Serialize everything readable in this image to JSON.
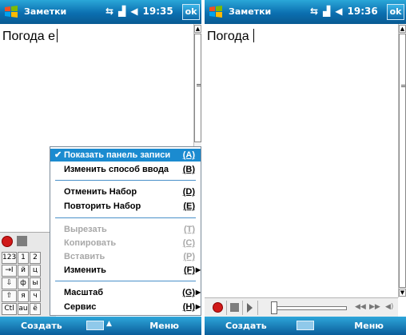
{
  "left": {
    "title": "Заметки",
    "status": {
      "connectivity_icon": "connectivity-icon",
      "signal_icon": "signal-icon",
      "volume_icon": "volume-icon",
      "time": "19:35"
    },
    "ok_label": "ok",
    "note_text": "Погода е",
    "menu": {
      "items": [
        {
          "label": "Показать панель записи",
          "key": "(A)",
          "checked": true,
          "selected": true,
          "disabled": false,
          "submenu": false
        },
        {
          "label": "Изменить способ ввода",
          "key": "(B)",
          "checked": false,
          "selected": false,
          "disabled": false,
          "submenu": false
        },
        {
          "label": "Отменить Набор",
          "key": "(D)",
          "checked": false,
          "selected": false,
          "disabled": false,
          "submenu": false
        },
        {
          "label": "Повторить Набор",
          "key": "(E)",
          "checked": false,
          "selected": false,
          "disabled": false,
          "submenu": false
        },
        {
          "label": "Вырезать",
          "key": "(T)",
          "checked": false,
          "selected": false,
          "disabled": true,
          "submenu": false
        },
        {
          "label": "Копировать",
          "key": "(C)",
          "checked": false,
          "selected": false,
          "disabled": true,
          "submenu": false
        },
        {
          "label": "Вставить",
          "key": "(P)",
          "checked": false,
          "selected": false,
          "disabled": true,
          "submenu": false
        },
        {
          "label": "Изменить",
          "key": "(F)",
          "checked": false,
          "selected": false,
          "disabled": false,
          "submenu": true
        },
        {
          "label": "Масштаб",
          "key": "(G)",
          "checked": false,
          "selected": false,
          "disabled": false,
          "submenu": true
        },
        {
          "label": "Сервис",
          "key": "(H)",
          "checked": false,
          "selected": false,
          "disabled": false,
          "submenu": true
        }
      ]
    },
    "keyboard": {
      "keys": [
        "123",
        "1",
        "2",
        "→I",
        "й",
        "ц",
        "⇩",
        "ф",
        "ы",
        "⇧",
        "я",
        "ч",
        "Ctl",
        "au",
        "ё"
      ]
    },
    "softkeys": {
      "left": "Создать",
      "right": "Меню"
    }
  },
  "right": {
    "title": "Заметки",
    "status": {
      "time": "19:36"
    },
    "ok_label": "ok",
    "note_text": "Погода",
    "softkeys": {
      "left": "Создать",
      "right": "Меню"
    }
  },
  "colors": {
    "title_bar": "#0b6fb0",
    "menu_highlight": "#1b8bd0",
    "record": "#d01919"
  }
}
